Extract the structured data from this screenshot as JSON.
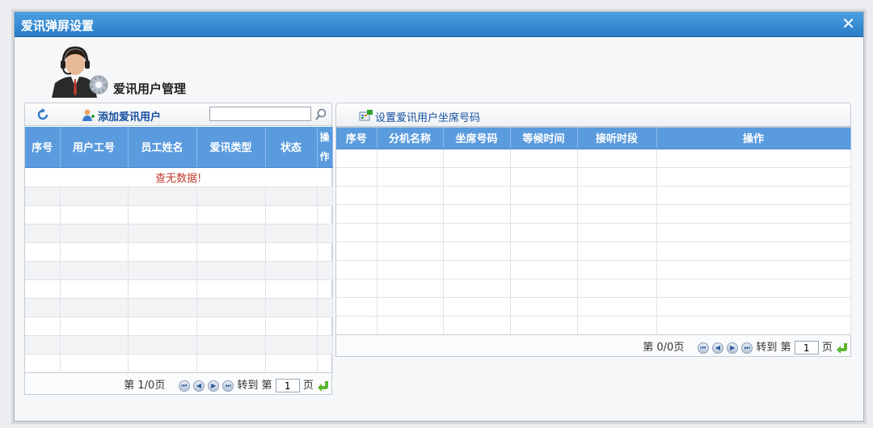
{
  "dialog": {
    "title": "爱讯弹屏设置",
    "close_glyph": "✕"
  },
  "header": {
    "title": "爱讯用户管理",
    "icon": "agent-headset-icon"
  },
  "left": {
    "add_label": "添加爱讯用户",
    "search_value": "",
    "columns": [
      "序号",
      "用户工号",
      "员工姓名",
      "爱讯类型",
      "状态",
      "操作"
    ],
    "empty_message": "查无数据!",
    "pager": {
      "page_text": "第 1/0页",
      "goto_label": "转到 第",
      "page_value": "1",
      "page_suffix": "页"
    }
  },
  "right": {
    "set_label": "设置爱讯用户坐席号码",
    "columns": [
      "序号",
      "分机名称",
      "坐席号码",
      "等候时间",
      "接听时段",
      "操作"
    ],
    "pager": {
      "page_text": "第 0/0页",
      "goto_label": "转到 第",
      "page_value": "1",
      "page_suffix": "页"
    }
  },
  "colors": {
    "header_blue": "#5a9bde",
    "title_blue": "#2a7cc6",
    "empty_red": "#c0392b",
    "link_blue": "#1650a0"
  }
}
